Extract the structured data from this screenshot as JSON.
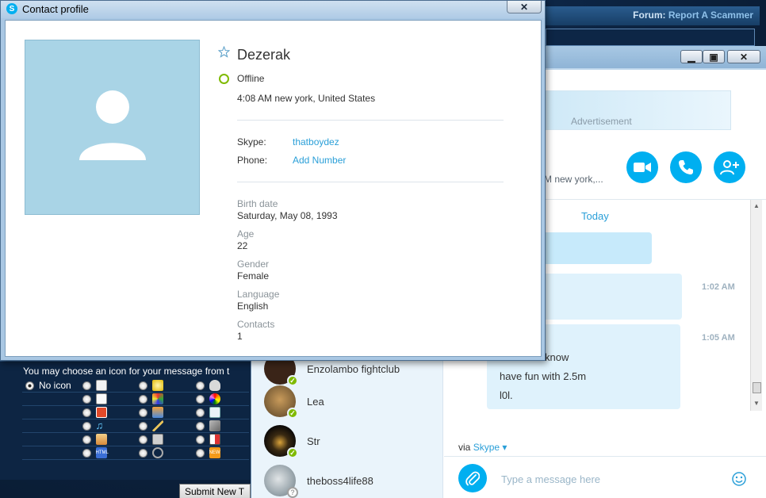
{
  "colors": {
    "skype_blue": "#00aff0",
    "online_green": "#7fba00",
    "link_blue": "#2a9fd8"
  },
  "forum": {
    "topbar_prefix": "Forum:",
    "topbar_crumb": "Report A Scammer",
    "icon_prompt": "You may choose an icon for your message from t",
    "no_icon_label": "No icon",
    "submit_label": "Submit New T"
  },
  "profile_dialog": {
    "title": "Contact profile",
    "close_label": "✕",
    "name": "Dezerak",
    "status": "Offline",
    "local_time": "4:08 AM new york, United States",
    "skype_label": "Skype:",
    "skype_value": "thatboydez",
    "phone_label": "Phone:",
    "phone_value": "Add Number",
    "details": [
      {
        "label": "Birth date",
        "value": "Saturday, May 08, 1993"
      },
      {
        "label": "Age",
        "value": "22"
      },
      {
        "label": "Gender",
        "value": "Female"
      },
      {
        "label": "Language",
        "value": "English"
      },
      {
        "label": "Contacts",
        "value": "1"
      }
    ]
  },
  "skype_window": {
    "ad_label": "Advertisement",
    "header_location": "M new york,...",
    "today_label": "Today",
    "messages": [
      {
        "time": "1:02 AM",
        "lines": []
      },
      {
        "time": "1:05 AM",
        "lines": [
          "know",
          "have fun with 2.5m",
          "l0l."
        ]
      }
    ],
    "contacts": [
      {
        "name": "Enzolambo fightclub",
        "status": "online",
        "avatar_color": "#3a2418"
      },
      {
        "name": "Lea",
        "status": "online",
        "avatar_color": "#8a6a3e"
      },
      {
        "name": "Str",
        "status": "online",
        "avatar_color": "#1a1410"
      },
      {
        "name": "theboss4life88",
        "status": "offline",
        "avatar_color": "#9aa6ad"
      }
    ],
    "via_prefix": "via",
    "via_link": "Skype ▾",
    "compose_placeholder": "Type a message here"
  }
}
